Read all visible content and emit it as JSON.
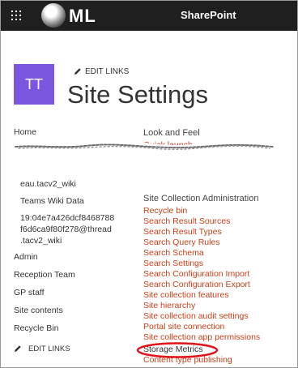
{
  "suite": {
    "logo_text": "ML",
    "title": "SharePoint"
  },
  "header": {
    "tile_initials": "TT",
    "edit_links": "EDIT LINKS",
    "site_title": "Site Settings"
  },
  "leftnav": {
    "items": [
      {
        "label": "Home"
      },
      {
        "label": "eau.tacv2_wiki"
      },
      {
        "label": "Teams Wiki Data"
      },
      {
        "label": "19:04e7a426dcf8468788"
      },
      {
        "label": "f6d6ca9f80f278@thread"
      },
      {
        "label": ".tacv2_wiki"
      },
      {
        "label": "Admin"
      },
      {
        "label": "Reception Team"
      },
      {
        "label": "GP staff"
      },
      {
        "label": "Site contents"
      },
      {
        "label": "Recycle Bin"
      }
    ],
    "edit_links": "EDIT LINKS"
  },
  "look_and_feel": {
    "heading": "Look and Feel",
    "links": [
      {
        "label": "Quick launch"
      }
    ]
  },
  "site_collection_admin": {
    "heading": "Site Collection Administration",
    "links": [
      {
        "label": "Recycle bin"
      },
      {
        "label": "Search Result Sources"
      },
      {
        "label": "Search Result Types"
      },
      {
        "label": "Search Query Rules"
      },
      {
        "label": "Search Schema"
      },
      {
        "label": "Search Settings"
      },
      {
        "label": "Search Configuration Import"
      },
      {
        "label": "Search Configuration Export"
      },
      {
        "label": "Site collection features"
      },
      {
        "label": "Site hierarchy"
      },
      {
        "label": "Site collection audit settings"
      },
      {
        "label": "Portal site connection"
      },
      {
        "label": "Site collection app permissions"
      },
      {
        "label": "Storage Metrics"
      },
      {
        "label": "Content type publishing"
      }
    ]
  },
  "colors": {
    "suitebar": "#1f1f1f",
    "tile": "#7b57e0",
    "link": "#c8411a",
    "highlight": "#e0141a"
  },
  "icons": [
    "waffle-icon",
    "pencil-icon"
  ]
}
